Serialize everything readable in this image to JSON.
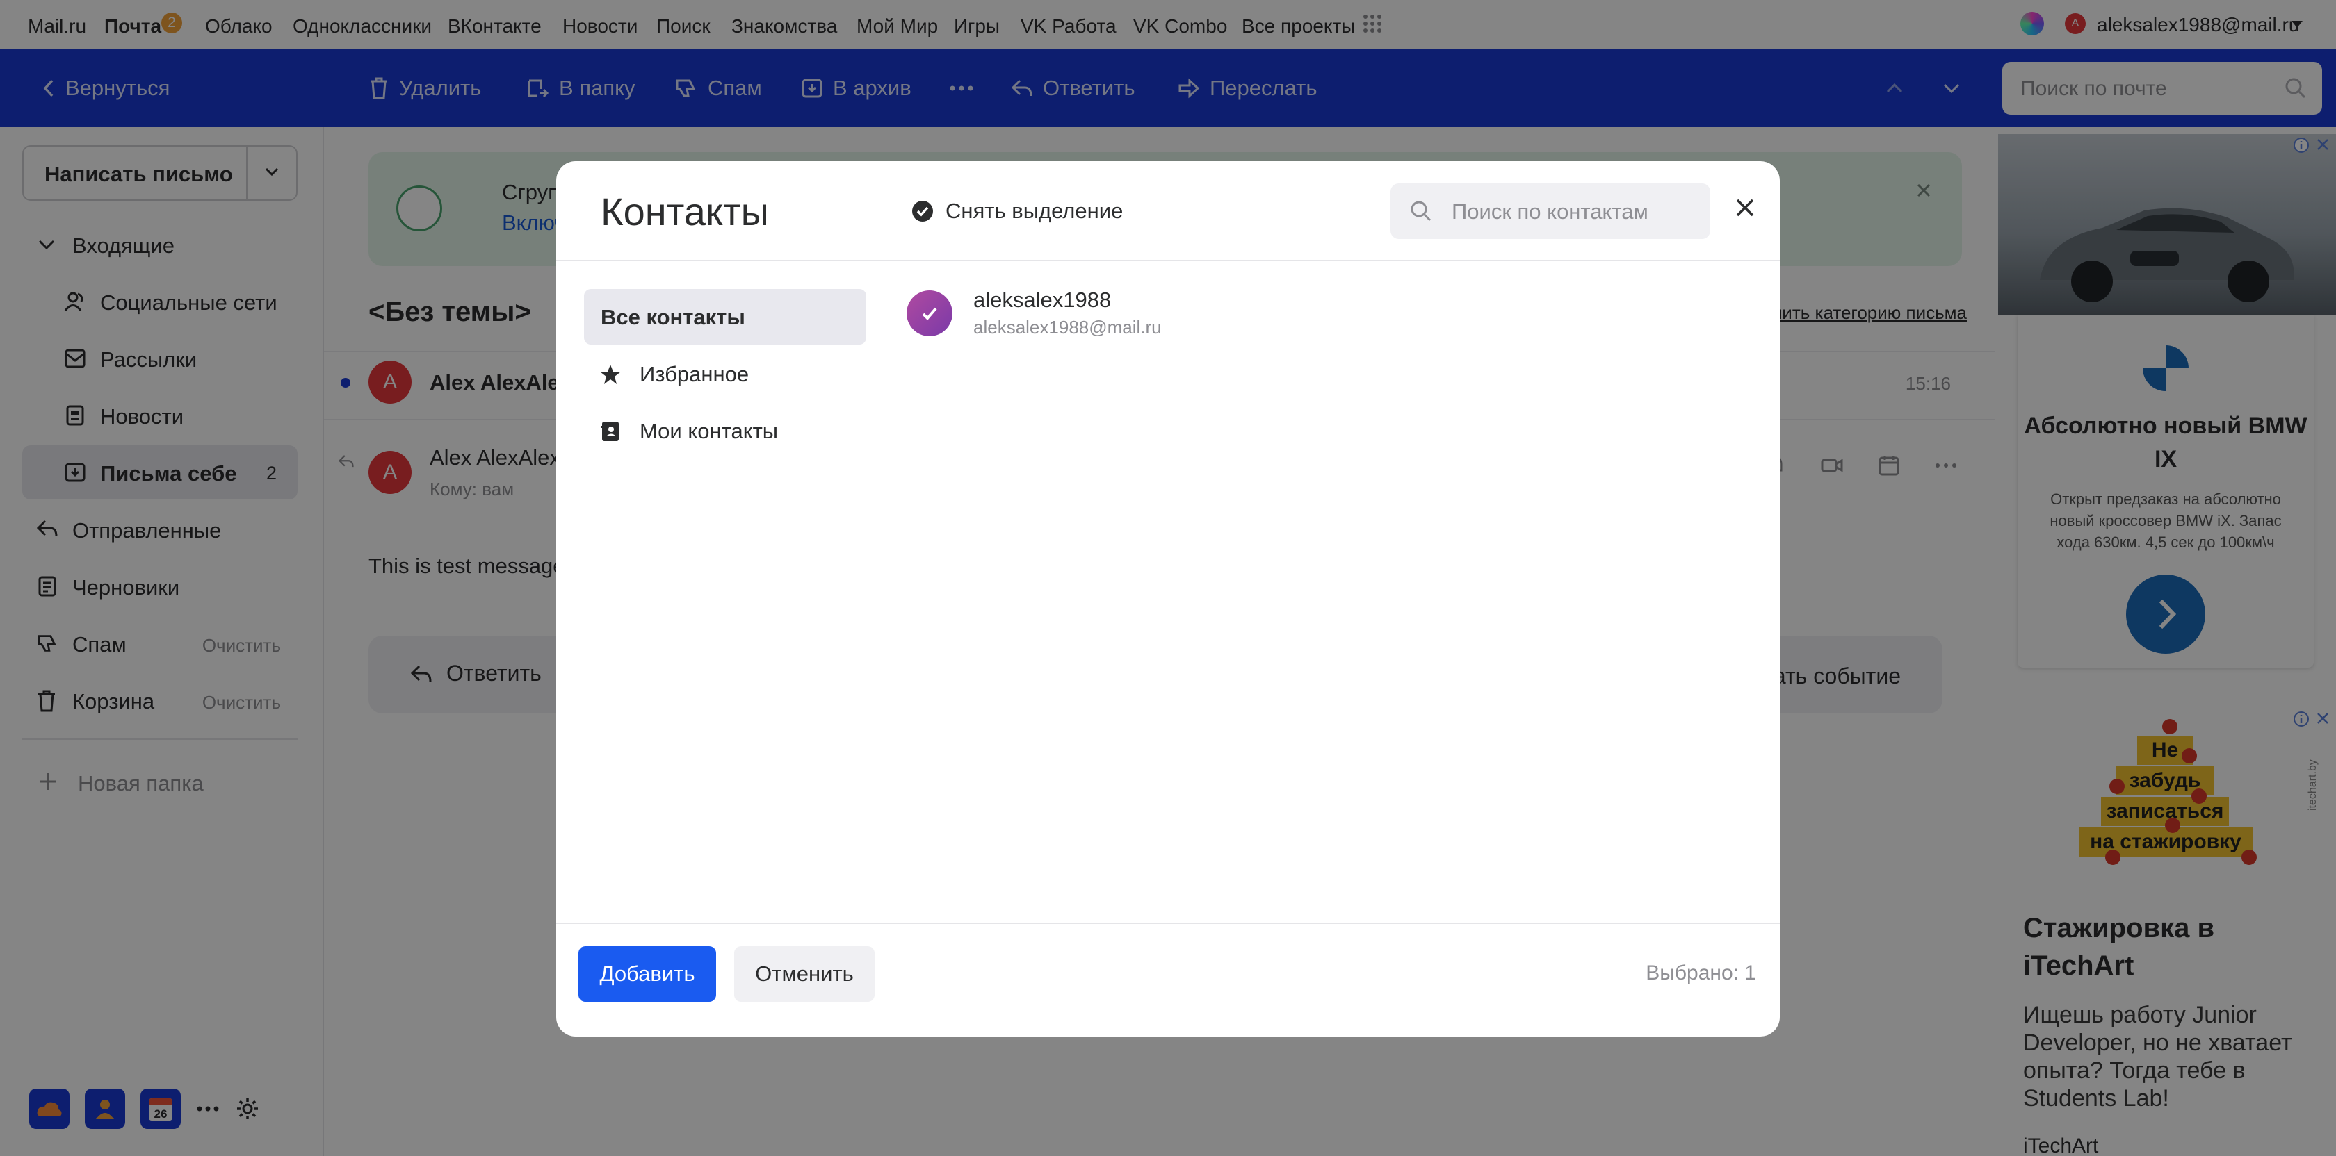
{
  "portal": {
    "links": [
      "Mail.ru",
      "Почта",
      "Облако",
      "Одноклассники",
      "ВКонтакте",
      "Новости",
      "Поиск",
      "Знакомства",
      "Мой Мир",
      "Игры",
      "VK Работа",
      "VK Combo",
      "Все проекты"
    ],
    "mail_badge": "2",
    "user_initial": "A",
    "user_email": "aleksalex1988@mail.ru"
  },
  "toolbar": {
    "back": "Вернуться",
    "delete": "Удалить",
    "to_folder": "В папку",
    "spam": "Спам",
    "archive": "В архив",
    "reply": "Ответить",
    "forward": "Переслать",
    "search_placeholder": "Поиск по почте"
  },
  "sidebar": {
    "compose": "Написать письмо",
    "inbox": "Входящие",
    "social": "Социальные сети",
    "newsletters": "Рассылки",
    "news": "Новости",
    "to_self": "Письма себе",
    "to_self_count": "2",
    "sent": "Отправленные",
    "drafts": "Черновики",
    "spam": "Спам",
    "trash": "Корзина",
    "clear": "Очистить",
    "new_folder": "Новая папка",
    "calendar_day": "26"
  },
  "reading": {
    "banner_line1": "Сгруппиру",
    "banner_line2": "Включить",
    "subject": "<Без темы>",
    "change_category": "Изменить категорию письма",
    "thread_sender": "Alex AlexAle",
    "thread_time": "15:16",
    "avatar_initial": "A",
    "message_sender": "Alex AlexAlex",
    "message_to": "Кому: вам",
    "body": "This is test message",
    "reply": "Ответить",
    "create_event": "Создать событие"
  },
  "ads": {
    "ad1_title": "Абсолютно новый BMW IX",
    "ad1_text": "Открыт предзаказ на абсолютно новый кроссовер BMW iX. Запас хода 630км. 4,5 сек до 100км\\ч",
    "ad2_stripes": [
      "Не",
      "забудь",
      "записаться",
      "на стажировку"
    ],
    "ad2_vertical": "itechart.by",
    "ad2_title": "Стажировка в iTechArt",
    "ad2_text": "Ищешь работу Junior Developer, но не хватает опыта? Тогда тебе в Students Lab!",
    "ad2_source": "iTechArt"
  },
  "modal": {
    "title": "Контакты",
    "deselect": "Снять выделение",
    "search_placeholder": "Поиск по контактам",
    "categories": [
      "Все контакты",
      "Избранное",
      "Мои контакты"
    ],
    "contact": {
      "name": "aleksalex1988",
      "email": "aleksalex1988@mail.ru"
    },
    "add_button": "Добавить",
    "cancel_button": "Отменить",
    "selected_count": "Выбрано: 1"
  },
  "colors": {
    "toolbar_blue": "#1a3bd5",
    "primary_button": "#1a5bf0",
    "badge_orange": "#f2a13b",
    "avatar_red": "#e6393c"
  }
}
